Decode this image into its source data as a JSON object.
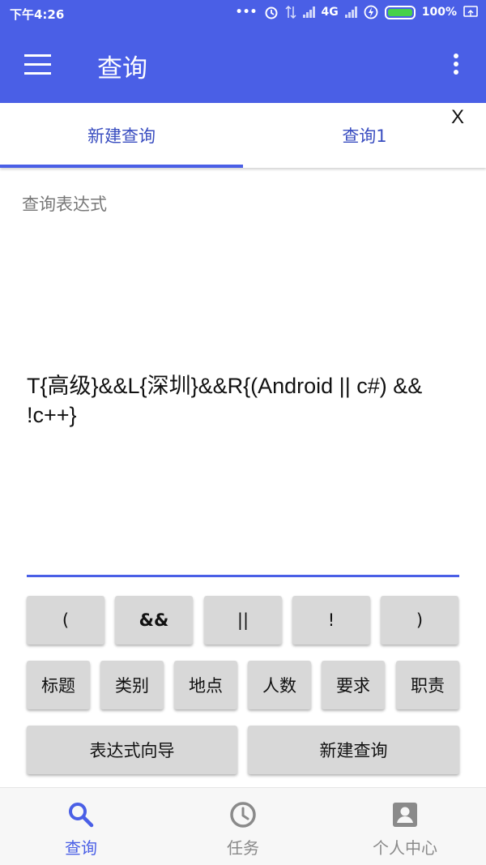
{
  "status_bar": {
    "time": "下午4:26",
    "network": "4G",
    "battery": "100%",
    "battery_level": 1.0
  },
  "app_bar": {
    "title": "查询",
    "menu_icon": "hamburger-menu-icon",
    "more_icon": "more-vert-icon"
  },
  "tabs": {
    "items": [
      {
        "label": "新建查询",
        "active": true
      },
      {
        "label": "查询1",
        "active": false
      }
    ],
    "close_label": "X"
  },
  "query": {
    "label": "查询表达式",
    "expression": "T{高级}&&L{深圳}&&R{(Android || c#) && !c++}"
  },
  "operator_keys": [
    "(",
    "&&",
    "||",
    "!",
    ")"
  ],
  "field_keys": [
    "标题",
    "类别",
    "地点",
    "人数",
    "要求",
    "职责"
  ],
  "action_keys": [
    "表达式向导",
    "新建查询"
  ],
  "bottom_nav": {
    "items": [
      {
        "label": "查询",
        "icon": "search-icon",
        "active": true
      },
      {
        "label": "任务",
        "icon": "clock-icon",
        "active": false
      },
      {
        "label": "个人中心",
        "icon": "account-box-icon",
        "active": false
      }
    ]
  },
  "colors": {
    "primary": "#4a5fe6",
    "key_bg": "#d8d8d8",
    "inactive": "#8a8a8a"
  }
}
